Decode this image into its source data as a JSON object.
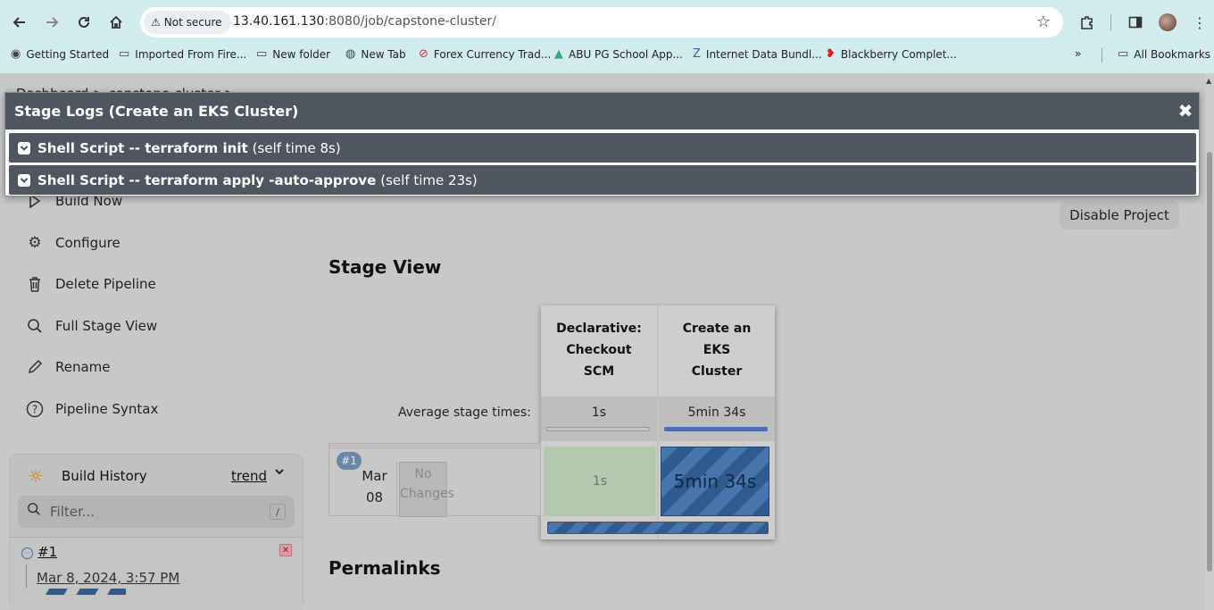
{
  "browser": {
    "security_label": "Not secure",
    "url_host": "13.40.161.130",
    "url_rest": ":8080/job/capstone-cluster/",
    "bookmarks": [
      {
        "label": "Getting Started",
        "icon": "firefox-icon"
      },
      {
        "label": "Imported From Fire...",
        "icon": "folder-icon"
      },
      {
        "label": "New folder",
        "icon": "folder-icon"
      },
      {
        "label": "New Tab",
        "icon": "globe-icon"
      },
      {
        "label": "Forex Currency Trad...",
        "icon": "forex-icon"
      },
      {
        "label": "ABU PG School App...",
        "icon": "abu-icon"
      },
      {
        "label": "Internet Data Bundl...",
        "icon": "z-icon"
      },
      {
        "label": "Blackberry Complet...",
        "icon": "airtel-icon"
      }
    ],
    "more_bookmarks": "»",
    "all_bookmarks": "All Bookmarks"
  },
  "sidebar": {
    "breadcrumb": "Dashboard > capstone-cluster >",
    "items": [
      {
        "label": "Build Now",
        "icon": "play-icon"
      },
      {
        "label": "Configure",
        "icon": "gear-icon"
      },
      {
        "label": "Delete Pipeline",
        "icon": "trash-icon"
      },
      {
        "label": "Full Stage View",
        "icon": "search-icon"
      },
      {
        "label": "Rename",
        "icon": "pencil-icon"
      },
      {
        "label": "Pipeline Syntax",
        "icon": "help-icon"
      }
    ]
  },
  "main": {
    "disable_button": "Disable Project",
    "stage_view_title": "Stage View",
    "permalinks_title": "Permalinks",
    "avg_label": "Average stage times:",
    "stages": [
      {
        "name": "Declarative: Checkout SCM",
        "avg": "1s",
        "avg_fill": 0,
        "run_time": "1s",
        "status": "success"
      },
      {
        "name": "Create an EKS Cluster",
        "avg": "5min 34s",
        "avg_fill": 1,
        "run_time": "5min 34s",
        "status": "in-progress"
      }
    ],
    "build": {
      "badge": "#1",
      "month": "Mar",
      "day": "08",
      "changes": "No Changes"
    }
  },
  "history": {
    "title": "Build History",
    "trend": "trend",
    "filter_placeholder": "Filter...",
    "filter_key": "/",
    "builds": [
      {
        "number": "#1",
        "date": "Mar 8, 2024, 3:57 PM"
      }
    ]
  },
  "modal": {
    "title": "Stage Logs (Create an EKS Cluster)",
    "close": "✖",
    "logs": [
      {
        "step": "Shell Script -- terraform init",
        "self_time": "(self time 8s)"
      },
      {
        "step": "Shell Script -- terraform apply -auto-approve",
        "self_time": "(self time 23s)"
      }
    ]
  },
  "colors": {
    "chrome": "#d2ecee",
    "modal_header": "#4f565f",
    "success_cell": "#b4c8b0",
    "running_cell": "#2f5b91"
  }
}
